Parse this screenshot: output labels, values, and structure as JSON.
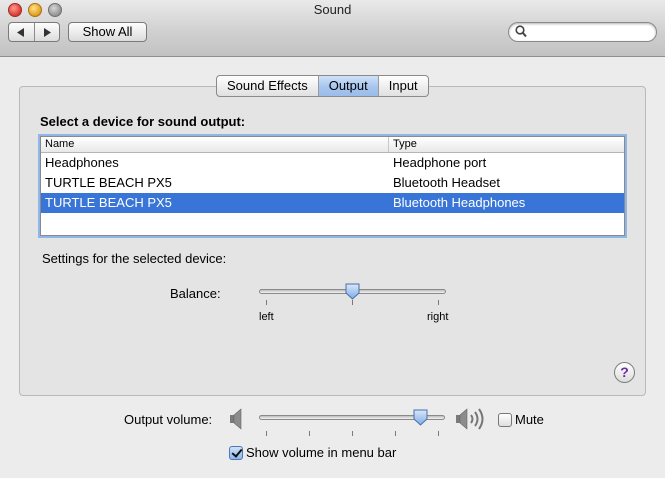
{
  "window": {
    "title": "Sound"
  },
  "toolbar": {
    "back_icon": "triangle-left-icon",
    "forward_icon": "triangle-right-icon",
    "show_all_label": "Show All",
    "search_icon": "magnifier-icon",
    "search_value": ""
  },
  "tabs": [
    {
      "label": "Sound Effects",
      "selected": false
    },
    {
      "label": "Output",
      "selected": true
    },
    {
      "label": "Input",
      "selected": false
    }
  ],
  "output": {
    "heading": "Select a device for sound output:",
    "columns": {
      "name": "Name",
      "type": "Type"
    },
    "devices": [
      {
        "name": "Headphones",
        "type": "Headphone port",
        "selected": false
      },
      {
        "name": "TURTLE BEACH PX5",
        "type": "Bluetooth Headset",
        "selected": false
      },
      {
        "name": "TURTLE BEACH PX5",
        "type": "Bluetooth Headphones",
        "selected": true
      }
    ],
    "settings_label": "Settings for the selected device:",
    "balance": {
      "label": "Balance:",
      "left_label": "left",
      "right_label": "right",
      "value": 0.5
    }
  },
  "help_label": "?",
  "volume": {
    "label": "Output volume:",
    "value": 0.9,
    "mute_label": "Mute",
    "muted": false,
    "show_in_menubar_label": "Show volume in menu bar",
    "show_in_menubar": true
  },
  "colors": {
    "selection": "#3875d7",
    "tab_selected": "#a7c6ee",
    "help_icon": "#6b2fa3"
  }
}
